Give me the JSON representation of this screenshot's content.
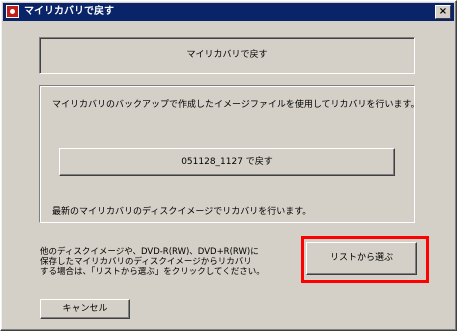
{
  "window": {
    "title": "マイリカバリで戻す",
    "close_label": "×"
  },
  "banner": {
    "text": "マイリカバリで戻す"
  },
  "restore_group": {
    "description": "マイリカバリのバックアップで作成したイメージファイルを使用してリカバリを行います。",
    "restore_button_label": "051128_1127 で戻す",
    "footer_text": "最新のマイリカバリのディスクイメージでリカバリを行います。"
  },
  "other_images": {
    "note_lines": [
      "他のディスクイメージや、DVD-R(RW)、DVD+R(RW)に",
      "保存したマイリカバリのディスクイメージからリカバリ",
      "する場合は、「リストから選ぶ」をクリックしてください。"
    ],
    "choose_button_label": "リストから選ぶ"
  },
  "cancel_button_label": "キャンセル",
  "highlight_color": "#ff0000"
}
